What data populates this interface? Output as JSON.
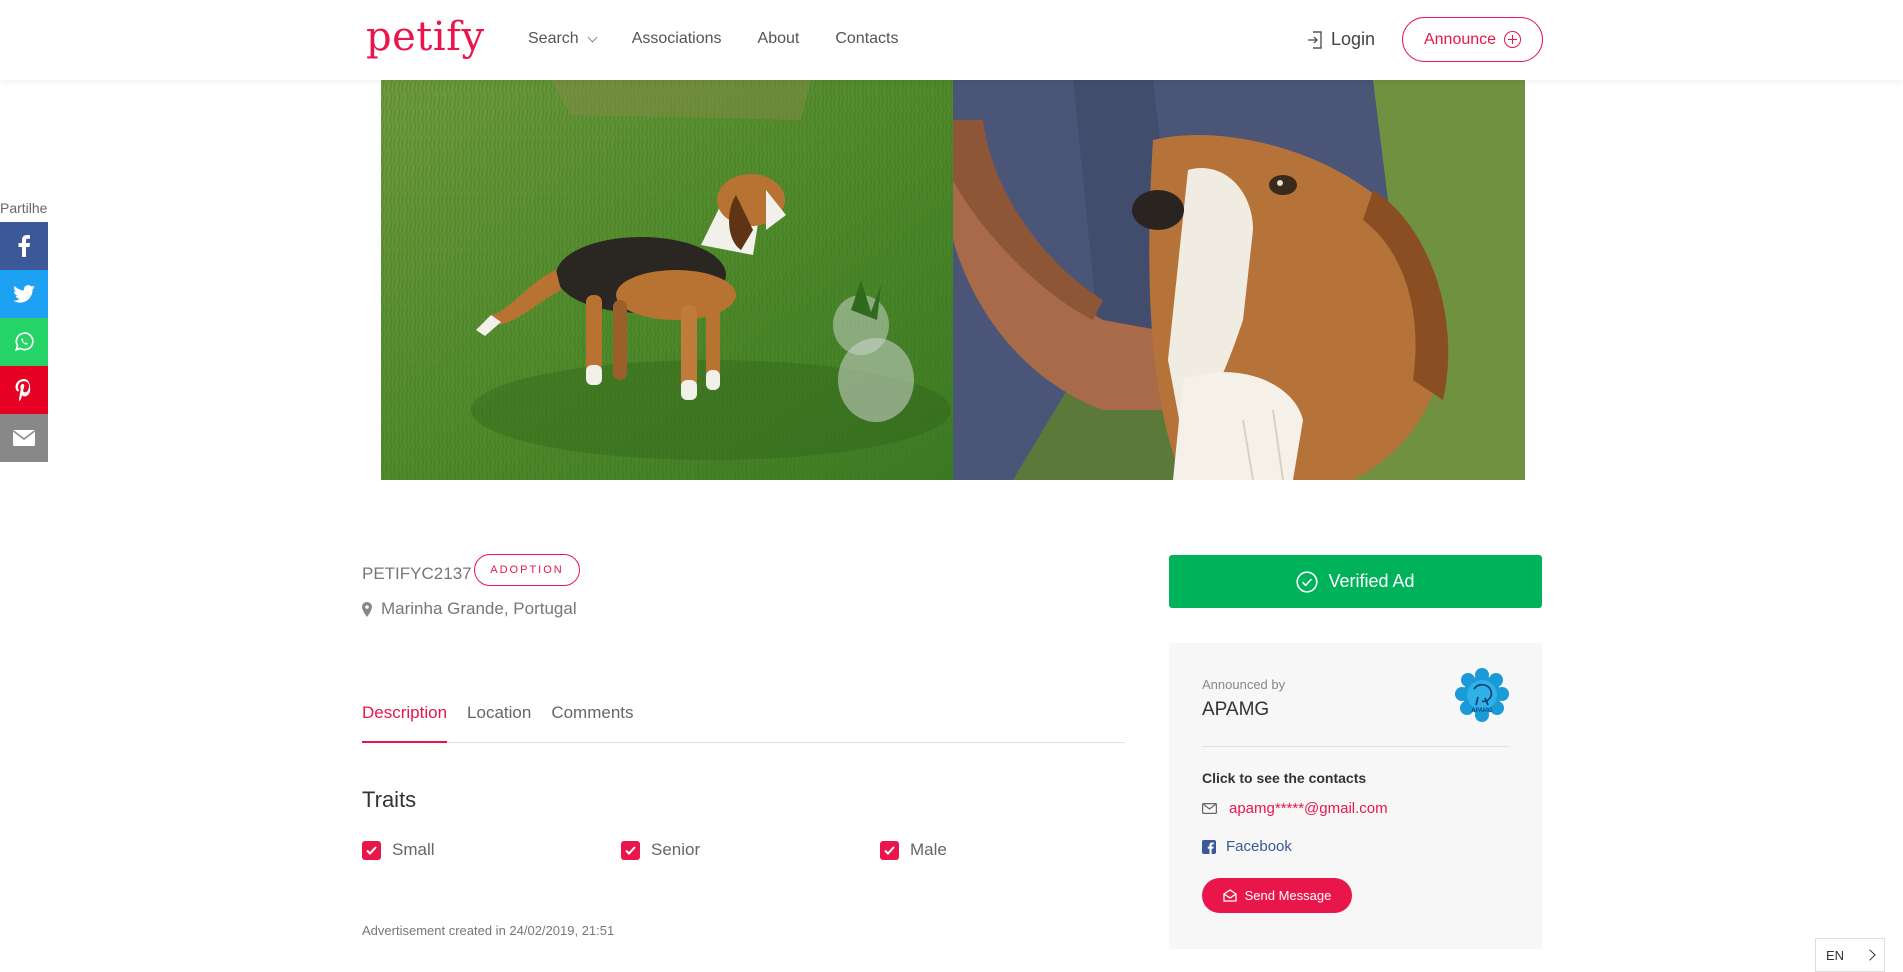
{
  "header": {
    "logo": "petify",
    "nav": [
      {
        "label": "Search",
        "dropdown": true
      },
      {
        "label": "Associations"
      },
      {
        "label": "About"
      },
      {
        "label": "Contacts"
      }
    ],
    "login_label": "Login",
    "announce_label": "Announce",
    "brand_color": "#e8164b"
  },
  "share": {
    "label": "Partilhe",
    "buttons": [
      {
        "name": "facebook",
        "icon": "facebook-icon",
        "color": "#3b5998"
      },
      {
        "name": "twitter",
        "icon": "twitter-icon",
        "color": "#1da1f2"
      },
      {
        "name": "whatsapp",
        "icon": "whatsapp-icon",
        "color": "#25d366"
      },
      {
        "name": "pinterest",
        "icon": "pinterest-icon",
        "color": "#e60023"
      },
      {
        "name": "email",
        "icon": "envelope-icon",
        "color": "#888888"
      }
    ]
  },
  "ad": {
    "id": "PETIFYC2137",
    "type_badge": "ADOPTION",
    "location": "Marinha Grande, Portugal",
    "tabs": [
      {
        "label": "Description",
        "active": true
      },
      {
        "label": "Location",
        "active": false
      },
      {
        "label": "Comments",
        "active": false
      }
    ],
    "traits_title": "Traits",
    "traits": [
      {
        "label": "Small",
        "checked": true
      },
      {
        "label": "Senior",
        "checked": true
      },
      {
        "label": "Male",
        "checked": true
      }
    ],
    "created": "Advertisement created in 24/02/2019, 21:51"
  },
  "sidebar": {
    "verified_label": "Verified Ad",
    "verified_color": "#00b25a",
    "announced_by_label": "Announced by",
    "announcer": "APAMG",
    "logo_text": "APAMG",
    "contacts_label": "Click to see the contacts",
    "email": "apamg*****@gmail.com",
    "facebook": "Facebook",
    "send_message": "Send Message"
  },
  "language": "EN"
}
